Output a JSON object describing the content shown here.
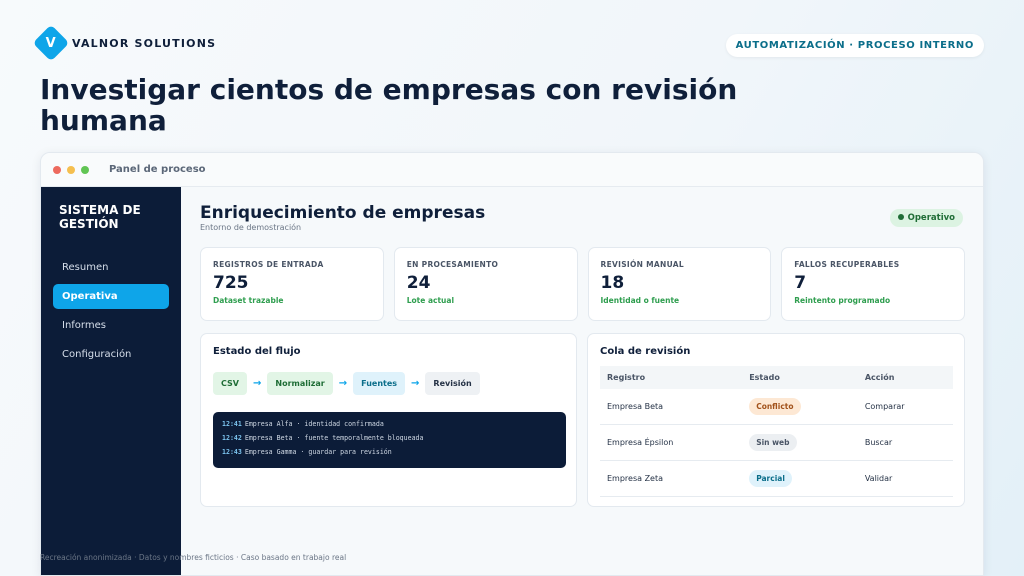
{
  "brand": {
    "logo_letter": "V",
    "name": "VALNOR SOLUTIONS"
  },
  "top_pill": "AUTOMATIZACIÓN · PROCESO INTERNO",
  "headline": "Investigar cientos de empresas con revisión humana",
  "window": {
    "title": "Panel de proceso",
    "dots": [
      "#ed6a5e",
      "#f5bf4f",
      "#61c554"
    ]
  },
  "sidebar": {
    "title": "SISTEMA DE GESTIÓN",
    "items": [
      {
        "label": "Resumen",
        "active": false
      },
      {
        "label": "Operativa",
        "active": true
      },
      {
        "label": "Informes",
        "active": false
      },
      {
        "label": "Configuración",
        "active": false
      }
    ]
  },
  "main": {
    "title": "Enriquecimiento de empresas",
    "subtitle": "Entorno de demostración",
    "status": "Operativo"
  },
  "cards": [
    {
      "label": "REGISTROS DE ENTRADA",
      "value": "725",
      "note": "Dataset trazable"
    },
    {
      "label": "EN PROCESAMIENTO",
      "value": "24",
      "note": "Lote actual"
    },
    {
      "label": "REVISIÓN MANUAL",
      "value": "18",
      "note": "Identidad o fuente"
    },
    {
      "label": "FALLOS RECUPERABLES",
      "value": "7",
      "note": "Reintento programado"
    }
  ],
  "flow": {
    "title": "Estado del flujo",
    "steps": [
      {
        "label": "CSV",
        "bg": "#e2f5e6",
        "fg": "#1f6d36"
      },
      {
        "label": "Normalizar",
        "bg": "#e2f5e6",
        "fg": "#1f6d36"
      },
      {
        "label": "Fuentes",
        "bg": "#dff2fb",
        "fg": "#0b6e8a"
      },
      {
        "label": "Revisión",
        "bg": "#eef1f4",
        "fg": "#253246"
      }
    ],
    "arrow": "→",
    "log": [
      {
        "time": "12:41",
        "text": "Empresa Alfa · identidad confirmada"
      },
      {
        "time": "12:42",
        "text": "Empresa Beta · fuente temporalmente bloqueada"
      },
      {
        "time": "12:43",
        "text": "Empresa Gamma · guardar para revisión"
      }
    ]
  },
  "queue": {
    "title": "Cola de revisión",
    "headers": [
      "Registro",
      "Estado",
      "Acción"
    ],
    "rows": [
      {
        "registro": "Empresa Beta",
        "estado": "Conflicto",
        "estado_bg": "#fde8d4",
        "estado_fg": "#a2521b",
        "accion": "Comparar"
      },
      {
        "registro": "Empresa Épsilon",
        "estado": "Sin web",
        "estado_bg": "#eceff2",
        "estado_fg": "#4a5566",
        "accion": "Buscar"
      },
      {
        "registro": "Empresa Zeta",
        "estado": "Parcial",
        "estado_bg": "#dff2fb",
        "estado_fg": "#0b6e8a",
        "accion": "Validar"
      }
    ]
  },
  "footer": "Recreación anonimizada · Datos y nombres ficticios · Caso basado en trabajo real"
}
